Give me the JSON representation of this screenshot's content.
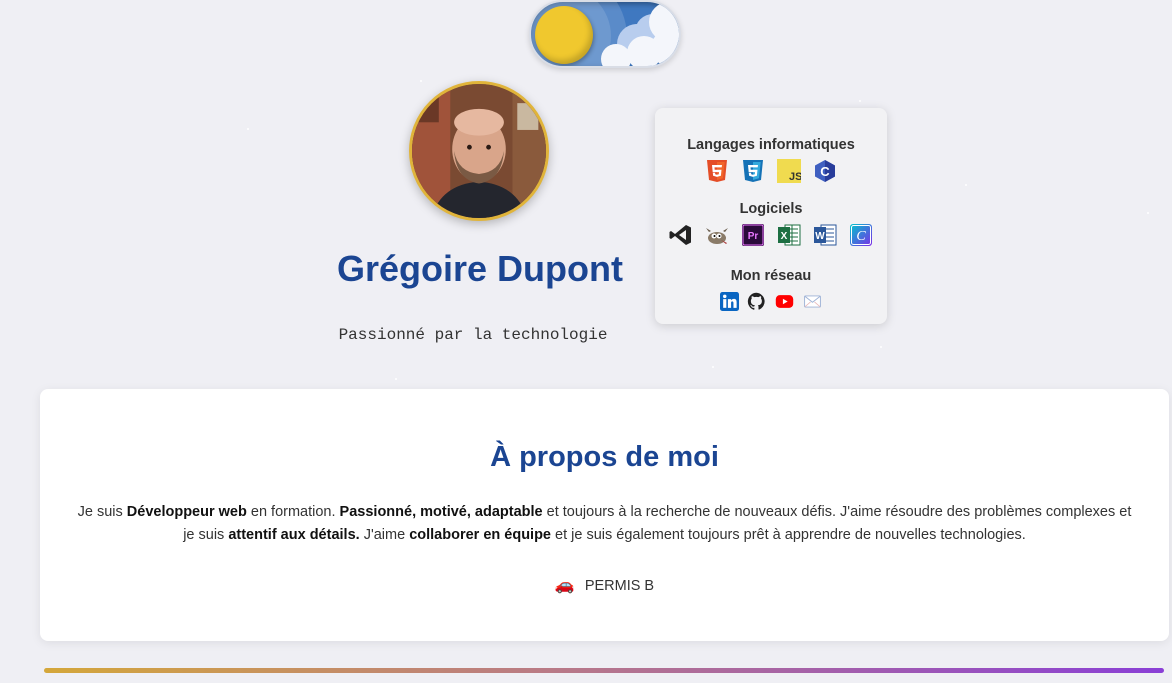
{
  "toggle": {
    "label": ""
  },
  "profile": {
    "name": "Grégoire Dupont",
    "tagline": "Passionné par la technologie"
  },
  "skills": {
    "languages_title": "Langages informatiques",
    "languages": [
      "html5-icon",
      "css3-icon",
      "js-icon",
      "c-icon"
    ],
    "software_title": "Logiciels",
    "software": [
      "vscode-icon",
      "gimp-icon",
      "premiere-icon",
      "excel-icon",
      "word-icon",
      "canva-icon"
    ],
    "network_title": "Mon réseau",
    "network": [
      "linkedin-icon",
      "github-icon",
      "youtube-icon",
      "mail-icon"
    ],
    "icon_labels": {
      "js": "JS",
      "c": "C",
      "pr": "Pr",
      "x": "X",
      "w": "W",
      "canva": "C"
    }
  },
  "about": {
    "title": "À propos de moi",
    "p1": "Je suis ",
    "b1": "Développeur web",
    "p2": " en formation. ",
    "b2": "Passionné, motivé, adaptable",
    "p3": " et toujours à la recherche de nouveaux défis. J'aime résoudre des problèmes complexes et je suis ",
    "b3": "attentif aux détails.",
    "p4": " J'aime ",
    "b4": "collaborer en équipe",
    "p5": " et je suis également toujours prêt à apprendre de nouvelles technologies.",
    "permis": "PERMIS B",
    "permis_icon": "car-icon"
  },
  "colors": {
    "accent": "#1b4592",
    "avatar_border": "#e0b43a",
    "bar_start": "#d4a73a",
    "bar_end": "#8a3fd6"
  }
}
